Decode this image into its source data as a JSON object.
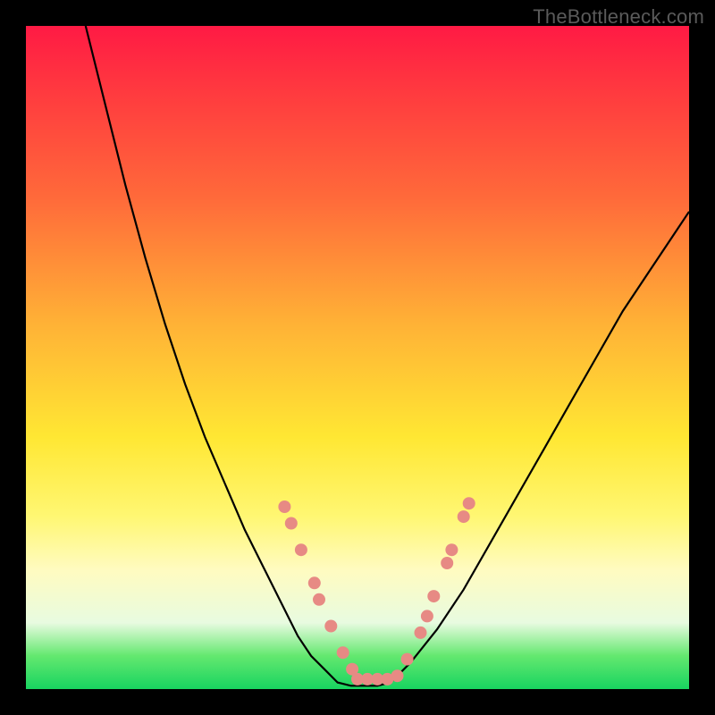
{
  "attribution": "TheBottleneck.com",
  "colors": {
    "background": "#000000",
    "curve_stroke": "#000000",
    "marker_fill": "#e78a84",
    "gradient_top": "#ff1a44",
    "gradient_bottom": "#18d460"
  },
  "chart_data": {
    "type": "line",
    "title": "",
    "xlabel": "",
    "ylabel": "",
    "xlim": [
      0,
      100
    ],
    "ylim": [
      0,
      100
    ],
    "series": [
      {
        "name": "left-curve",
        "x": [
          9,
          12,
          15,
          18,
          21,
          24,
          27,
          30,
          33,
          36,
          39,
          41,
          43,
          45,
          47
        ],
        "y": [
          100,
          88,
          76,
          65,
          55,
          46,
          38,
          31,
          24,
          18,
          12,
          8,
          5,
          3,
          1
        ]
      },
      {
        "name": "valley-floor",
        "x": [
          47,
          49,
          51,
          53,
          55
        ],
        "y": [
          1,
          0.5,
          0.5,
          0.5,
          1
        ]
      },
      {
        "name": "right-curve",
        "x": [
          55,
          58,
          62,
          66,
          70,
          74,
          78,
          82,
          86,
          90,
          94,
          98,
          100
        ],
        "y": [
          1,
          4,
          9,
          15,
          22,
          29,
          36,
          43,
          50,
          57,
          63,
          69,
          72
        ]
      }
    ],
    "markers": [
      {
        "group": "left-cluster",
        "x": 39.0,
        "y": 27.5
      },
      {
        "group": "left-cluster",
        "x": 40.0,
        "y": 25.0
      },
      {
        "group": "left-cluster",
        "x": 41.5,
        "y": 21.0
      },
      {
        "group": "left-cluster",
        "x": 43.5,
        "y": 16.0
      },
      {
        "group": "left-cluster",
        "x": 44.2,
        "y": 13.5
      },
      {
        "group": "left-cluster",
        "x": 46.0,
        "y": 9.5
      },
      {
        "group": "left-cluster",
        "x": 47.8,
        "y": 5.5
      },
      {
        "group": "left-cluster",
        "x": 49.2,
        "y": 3.0
      },
      {
        "group": "floor",
        "x": 50.0,
        "y": 1.5
      },
      {
        "group": "floor",
        "x": 51.5,
        "y": 1.5
      },
      {
        "group": "floor",
        "x": 53.0,
        "y": 1.5
      },
      {
        "group": "floor",
        "x": 54.5,
        "y": 1.5
      },
      {
        "group": "floor",
        "x": 56.0,
        "y": 2.0
      },
      {
        "group": "right-cluster",
        "x": 57.5,
        "y": 4.5
      },
      {
        "group": "right-cluster",
        "x": 59.5,
        "y": 8.5
      },
      {
        "group": "right-cluster",
        "x": 60.5,
        "y": 11.0
      },
      {
        "group": "right-cluster",
        "x": 61.5,
        "y": 14.0
      },
      {
        "group": "right-cluster",
        "x": 63.5,
        "y": 19.0
      },
      {
        "group": "right-cluster",
        "x": 64.2,
        "y": 21.0
      },
      {
        "group": "right-cluster",
        "x": 66.0,
        "y": 26.0
      },
      {
        "group": "right-cluster",
        "x": 66.8,
        "y": 28.0
      }
    ]
  }
}
